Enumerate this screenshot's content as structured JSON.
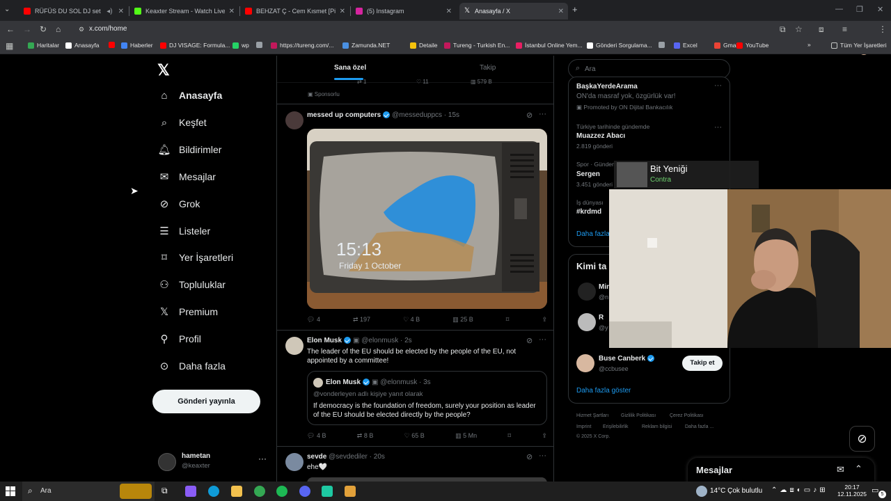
{
  "browser": {
    "tabs": [
      {
        "title": "RÜFÜS DU SOL DJ set | Clu",
        "active": false,
        "favicon_color": "#ff0000"
      },
      {
        "title": "Keaxter Stream - Watch Live o",
        "active": false,
        "favicon_color": "#53fc18"
      },
      {
        "title": "BEHZAT Ç - Cem Kısmet [Pilli B",
        "active": false,
        "favicon_color": "#ff0000"
      },
      {
        "title": "(5) Instagram",
        "active": false,
        "favicon_color": "#d6249f"
      },
      {
        "title": "Anasayfa / X",
        "active": true,
        "favicon_color": "#ffffff"
      }
    ],
    "new_tab": "+",
    "address": "x.com/home",
    "bookmarks": [
      {
        "label": "Haritalar",
        "color": "#34a853"
      },
      {
        "label": "Anasayfa",
        "color": "#ffffff"
      },
      {
        "label": "",
        "color": "#ff0000"
      },
      {
        "label": "Haberler",
        "color": "#4285f4"
      },
      {
        "label": "DJ VISAGE: Formula...",
        "color": "#ff0000"
      },
      {
        "label": "wp",
        "color": "#25d366"
      },
      {
        "label": "",
        "color": "#9aa0a6"
      },
      {
        "label": "https://tureng.com/...",
        "color": "#c2185b"
      },
      {
        "label": "Zamunda.NET",
        "color": "#4a90e2"
      },
      {
        "label": "Detaile",
        "color": "#f4c20d"
      },
      {
        "label": "Tureng - Turkish En...",
        "color": "#c2185b"
      },
      {
        "label": "İstanbul Online Yem...",
        "color": "#e91e63"
      },
      {
        "label": "Gönderi Sorgulama...",
        "color": "#ffffff"
      },
      {
        "label": "",
        "color": "#9aa0a6"
      },
      {
        "label": "Excel",
        "color": "#5865f2"
      },
      {
        "label": "Gmail",
        "color": "#ea4335"
      },
      {
        "label": "YouTube",
        "color": "#ff0000"
      }
    ],
    "all_bookmarks": "Tüm Yer İşaretleri"
  },
  "sidebar": {
    "items": [
      {
        "label": "Anasayfa",
        "icon": "home-icon"
      },
      {
        "label": "Keşfet",
        "icon": "search-icon"
      },
      {
        "label": "Bildirimler",
        "icon": "bell-icon"
      },
      {
        "label": "Mesajlar",
        "icon": "mail-icon"
      },
      {
        "label": "Grok",
        "icon": "grok-icon"
      },
      {
        "label": "Listeler",
        "icon": "list-icon"
      },
      {
        "label": "Yer İşaretleri",
        "icon": "bookmark-icon"
      },
      {
        "label": "Topluluklar",
        "icon": "people-icon"
      },
      {
        "label": "Premium",
        "icon": "x-logo-icon"
      },
      {
        "label": "Profil",
        "icon": "person-icon"
      },
      {
        "label": "Daha fazla",
        "icon": "more-circle-icon"
      }
    ],
    "post_button": "Gönderi yayınla",
    "account": {
      "name": "hametan",
      "handle": "@keaxter"
    }
  },
  "feed": {
    "tabs": [
      "Sana özel",
      "Takip"
    ],
    "sponsored": "Sponsorlu",
    "top_actions": {
      "reposts": "1",
      "likes": "11",
      "views": "579 B"
    },
    "tweets": [
      {
        "name": "messed up computers",
        "handle": "@messeduppcs",
        "time": "· 15s",
        "text": "",
        "replies": "4",
        "reposts": "197",
        "likes": "4 B",
        "views": "25 B",
        "image_clock": "15:13",
        "image_date": "Friday 1 October"
      },
      {
        "name": "Elon Musk",
        "handle": "@elonmusk",
        "time": "· 2s",
        "text": "The leader of the EU should be elected by the people of the EU, not appointed by a committee!",
        "quote": {
          "name": "Elon Musk",
          "handle": "@elonmusk",
          "time": "· 3s",
          "reply_to": "@vonderleyen adlı kişiye yanıt olarak",
          "text": "If democracy is the foundation of freedom, surely your position as leader of the EU should be elected directly by the people?"
        },
        "replies": "4 B",
        "reposts": "8 B",
        "likes": "65 B",
        "views": "5 Mn"
      },
      {
        "name": "sevde",
        "handle": "@sevdediler",
        "time": "· 20s",
        "text": "ehe🤍"
      }
    ]
  },
  "right": {
    "search_placeholder": "Ara",
    "ad": {
      "title": "BaşkaYerdeArama",
      "text": "ON'da masraf yok, özgürlük var!",
      "promo": "Promoted by ON Dijital Bankacılık"
    },
    "trends": [
      {
        "context": "Türkiye tarihinde gündemde",
        "name": "Muazzez Abacı",
        "count": "2.819 gönderi"
      },
      {
        "context": "Spor · Gündem",
        "name": "Sergen",
        "count": "3.451 gönderi"
      },
      {
        "context": "İş dünyası",
        "name": "#krdmd",
        "count": ""
      }
    ],
    "show_more": "Daha fazla",
    "who_to_follow": "Kimi ta",
    "follow_partial": [
      {
        "name": "Min",
        "handle": "@n"
      },
      {
        "name": "R",
        "handle": "@y"
      }
    ],
    "follow_user": {
      "name": "Buse Canberk",
      "handle": "@ccbusee",
      "button": "Takip et"
    },
    "show_more_follow": "Daha fazla göster",
    "footer": [
      "Hizmet Şartları",
      "Gizlilik Politikası",
      "Çerez Politikası",
      "Imprint",
      "Erişilebilirlik",
      "Reklam bilgisi",
      "Daha fazla ...",
      "© 2025 X Corp."
    ],
    "messages_drawer": "Mesajlar"
  },
  "overlay": {
    "song": "Bit Yeniği",
    "artist": "Contra"
  },
  "taskbar": {
    "search": "Ara",
    "weather": "14°C Çok bulutlu",
    "time": "20:17",
    "date": "12.11.2025",
    "notif_count": "5"
  }
}
